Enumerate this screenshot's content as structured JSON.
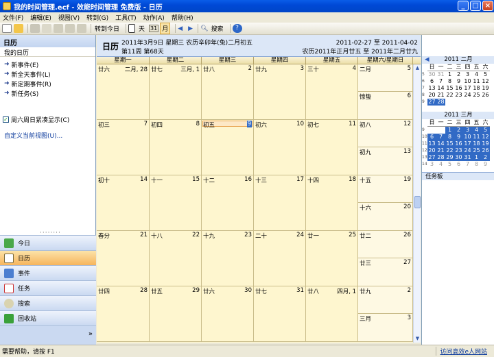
{
  "window": {
    "title": "我的时间管理.ecf - 效能时间管理 免费版 - 日历"
  },
  "menu": [
    "文件(F)",
    "编辑(E)",
    "视图(V)",
    "转到(G)",
    "工具(T)",
    "动作(A)",
    "帮助(H)"
  ],
  "toolbar": {
    "goto_today": "转到今日",
    "day": "天",
    "month_num": "31",
    "month": "月",
    "search": "搜索"
  },
  "left": {
    "header": "日历",
    "my_calendar": "我的日历",
    "links": [
      "新事件(E)",
      "新全天事件(L)",
      "新定期事件(R)",
      "新任务(S)"
    ],
    "compact_label": "周六周日紧凑显示(C)",
    "custom_view": "自定义当前视图(U)...",
    "nav": [
      "今日",
      "日历",
      "事件",
      "任务",
      "搜索",
      "回收站"
    ]
  },
  "calendar": {
    "title": "日历",
    "date_line": "2011年3月9日 星期三 农历辛卯年(兔)二月初五",
    "week_line": "第11周 第68天",
    "range": "2011-02-27 至 2011-04-02",
    "lunar_range": "农历2011年正月廿五 至 2011年二月廿九",
    "day_names": [
      "星期一",
      "星期二",
      "星期三",
      "星期四",
      "星期五",
      "星期六/星期日"
    ],
    "weeks": [
      [
        [
          "廿六",
          "二月, 28"
        ],
        [
          "廿七",
          "三月, 1"
        ],
        [
          "廿八",
          "2"
        ],
        [
          "廿九",
          "3"
        ],
        [
          "三十",
          "4"
        ],
        [
          "二月",
          "5"
        ],
        [
          "惊蛰",
          "6"
        ]
      ],
      [
        [
          "初三",
          "7"
        ],
        [
          "初四",
          "8"
        ],
        [
          "初五",
          "9"
        ],
        [
          "初六",
          "10"
        ],
        [
          "初七",
          "11"
        ],
        [
          "初八",
          "12"
        ],
        [
          "初九",
          "13"
        ]
      ],
      [
        [
          "初十",
          "14"
        ],
        [
          "十一",
          "15"
        ],
        [
          "十二",
          "16"
        ],
        [
          "十三",
          "17"
        ],
        [
          "十四",
          "18"
        ],
        [
          "十五",
          "19"
        ],
        [
          "十六",
          "20"
        ]
      ],
      [
        [
          "春分",
          "21"
        ],
        [
          "十八",
          "22"
        ],
        [
          "十九",
          "23"
        ],
        [
          "二十",
          "24"
        ],
        [
          "廿一",
          "25"
        ],
        [
          "廿二",
          "26"
        ],
        [
          "廿三",
          "27"
        ]
      ],
      [
        [
          "廿四",
          "28"
        ],
        [
          "廿五",
          "29"
        ],
        [
          "廿六",
          "30"
        ],
        [
          "廿七",
          "31"
        ],
        [
          "廿八",
          "四月, 1"
        ],
        [
          "廿九",
          "2"
        ],
        [
          "三月",
          "3"
        ]
      ]
    ]
  },
  "mini_feb": {
    "title": "2011 二月",
    "dow": [
      "日",
      "一",
      "二",
      "三",
      "四",
      "五",
      "六"
    ],
    "rows": [
      [
        "5",
        "30",
        "31",
        "1",
        "2",
        "3",
        "4",
        "5"
      ],
      [
        "6",
        "6",
        "7",
        "8",
        "9",
        "10",
        "11",
        "12"
      ],
      [
        "7",
        "13",
        "14",
        "15",
        "16",
        "17",
        "18",
        "19"
      ],
      [
        "8",
        "20",
        "21",
        "22",
        "23",
        "24",
        "25",
        "26"
      ],
      [
        "9",
        "27",
        "28",
        "",
        "",
        "",
        "",
        ""
      ]
    ]
  },
  "mini_mar": {
    "title": "2011 三月",
    "dow": [
      "日",
      "一",
      "二",
      "三",
      "四",
      "五",
      "六"
    ],
    "rows": [
      [
        "9",
        "",
        "",
        "1",
        "2",
        "3",
        "4",
        "5"
      ],
      [
        "10",
        "6",
        "7",
        "8",
        "9",
        "10",
        "11",
        "12"
      ],
      [
        "11",
        "13",
        "14",
        "15",
        "16",
        "17",
        "18",
        "19"
      ],
      [
        "12",
        "20",
        "21",
        "22",
        "23",
        "24",
        "25",
        "26"
      ],
      [
        "13",
        "27",
        "28",
        "29",
        "30",
        "31",
        "1",
        "2"
      ],
      [
        "14",
        "3",
        "4",
        "5",
        "6",
        "7",
        "8",
        "9"
      ]
    ]
  },
  "taskpad": "任务板",
  "status": {
    "help": "需要帮助，请按 F1",
    "link": "访问高效e人网站"
  }
}
